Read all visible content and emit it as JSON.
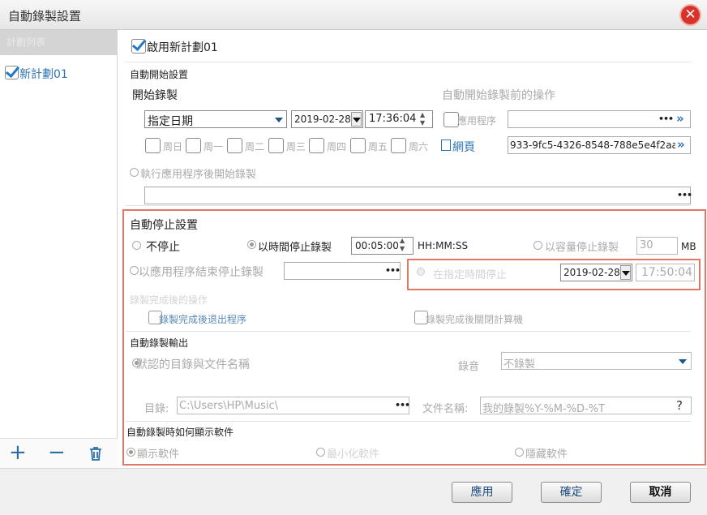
{
  "window": {
    "title": "自動錄製設置"
  },
  "sidebar": {
    "header": "計劃列表",
    "items": [
      {
        "label": "新計劃01",
        "checked": true
      }
    ]
  },
  "enable_plan": {
    "label": "啟用新計劃01",
    "checked": true
  },
  "auto_start": {
    "section_title": "自動開始設置",
    "start_label": "開始錄製",
    "mode_value": "指定日期",
    "date": "2019-02-28",
    "time": "17:36:04",
    "weekdays": [
      "周日",
      "周一",
      "周二",
      "周三",
      "周四",
      "周五",
      "周六"
    ],
    "pre_action_label": "自動開始錄製前的操作",
    "app_label": "應用程序",
    "web_label": "網頁",
    "web_value": "933-9fc5-4326-8548-788e5e4f2aa2",
    "exec_label": "執行應用程序後開始錄製"
  },
  "auto_stop": {
    "section_title": "自動停止設置",
    "no_stop": "不停止",
    "by_time": "以時間停止錄製",
    "time_value": "00:05:00",
    "time_format": "HH:MM:SS",
    "by_size": "以容量停止錄製",
    "size_value": "30",
    "size_unit": "MB",
    "by_app": "以應用程序結束停止錄製",
    "end_at_label": "在指定時間停止",
    "end_date": "2019-02-28",
    "end_time": "17:50:04",
    "after_label": "錄製完成後的操作",
    "exit_app": "錄製完成後退出程序",
    "shutdown": "錄製完成後關閉計算機"
  },
  "output": {
    "section_title": "自動錄製輸出",
    "default_label": "默認的目錄與文件名稱",
    "audio_label": "錄音",
    "audio_value": "不錄製",
    "dir_label": "目錄:",
    "dir_value": "C:\\Users\\HP\\Music\\",
    "filename_label": "文件名稱:",
    "filename_value": "我的錄製%Y-%M-%D-%T",
    "help": "?"
  },
  "display": {
    "section_title": "自動錄製時如何顯示軟件",
    "options": [
      "顯示軟件",
      "最小化軟件",
      "隱藏軟件"
    ]
  },
  "footer": {
    "apply": "應用",
    "ok": "確定",
    "cancel": "取消"
  },
  "colors": {
    "accent": "#2b73b6",
    "highlight_border": "#e07868",
    "close": "#d9322a"
  }
}
